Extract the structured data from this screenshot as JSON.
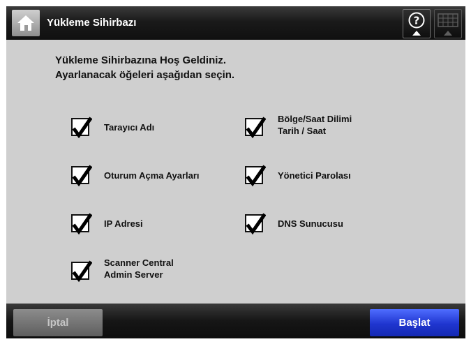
{
  "header": {
    "title": "Yükleme Sihirbazı",
    "home_icon": "home-icon",
    "help_icon": "help-icon",
    "keyboard_icon": "keyboard-icon"
  },
  "intro": {
    "line1": "Yükleme Sihirbazına Hoş Geldiniz.",
    "line2": "Ayarlanacak öğeleri aşağıdan seçin."
  },
  "options": {
    "scanner_name": {
      "label": "Tarayıcı Adı",
      "checked": true
    },
    "region_time": {
      "label_line1": "Bölge/Saat Dilimi",
      "label_line2": "Tarih / Saat",
      "checked": true
    },
    "logon_settings": {
      "label": "Oturum Açma Ayarları",
      "checked": true
    },
    "admin_password": {
      "label": "Yönetici Parolası",
      "checked": true
    },
    "ip_address": {
      "label": "IP Adresi",
      "checked": true
    },
    "dns_server": {
      "label": "DNS Sunucusu",
      "checked": true
    },
    "scanner_central": {
      "label_line1": "Scanner Central",
      "label_line2": "Admin Server",
      "checked": true
    }
  },
  "footer": {
    "cancel_label": "İptal",
    "start_label": "Başlat"
  },
  "colors": {
    "header_bg": "#1a1a1a",
    "content_bg": "#cfcfcf",
    "start_button": "#1f35cf",
    "cancel_button": "#6e6e6e"
  }
}
